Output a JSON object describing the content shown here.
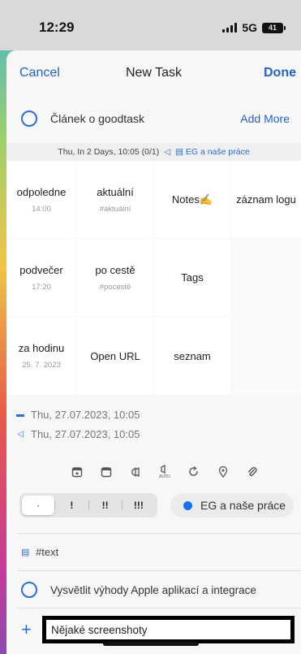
{
  "status_bar": {
    "time": "12:29",
    "network": "5G",
    "battery": "41"
  },
  "nav": {
    "cancel": "Cancel",
    "title": "New Task",
    "done": "Done"
  },
  "task": {
    "title": "Článek o goodtask",
    "add_more": "Add More"
  },
  "date_strip": {
    "text": "Thu, In 2 Days, 10:05 (0/1)",
    "list": "EG a naše práce"
  },
  "grid": [
    {
      "label": "odpoledne",
      "sub": "14:00"
    },
    {
      "label": "aktuální",
      "sub": "#aktuální"
    },
    {
      "label": "Notes✍️",
      "sub": ""
    },
    {
      "label": "záznam logu",
      "sub": ""
    },
    {
      "label": "podvečer",
      "sub": "17:20"
    },
    {
      "label": "po cestě",
      "sub": "#pocestě"
    },
    {
      "label": "Tags",
      "sub": ""
    },
    {
      "label": "za hodinu",
      "sub": "25. 7. 2023"
    },
    {
      "label": "Open URL",
      "sub": ""
    },
    {
      "label": "seznam",
      "sub": ""
    }
  ],
  "dates": {
    "due": "Thu, 27.07.2023, 10:05",
    "alert": "Thu, 27.07.2023, 10:05"
  },
  "toolbar": [
    "calendar-start-icon",
    "calendar-icon",
    "alert-icon",
    "auto-alert-icon",
    "repeat-icon",
    "location-icon",
    "attachment-icon"
  ],
  "priority": {
    "options": [
      "·",
      "!",
      "!!",
      "!!!"
    ],
    "selected": 0
  },
  "list": {
    "name": "EG a naše práce",
    "color": "#1a6ff0"
  },
  "tag": {
    "text": "#text"
  },
  "subtask": {
    "title": "Vysvětlit výhody Apple aplikací a integrace"
  },
  "new_subtask": {
    "value": "Nějaké screenshoty"
  },
  "colors": {
    "accent": "#2563c5",
    "sheet": "#f7f7f7"
  }
}
